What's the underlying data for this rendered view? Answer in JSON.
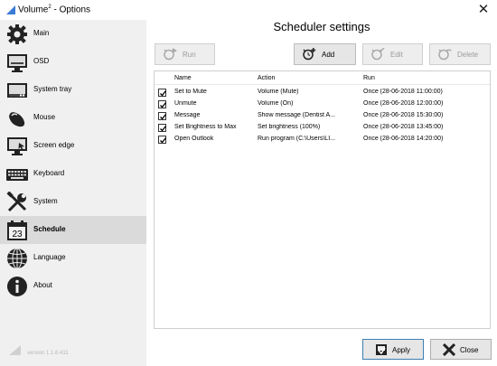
{
  "window": {
    "title_main": "Volume",
    "title_sup": "2",
    "title_suffix": " - Options",
    "close_glyph": "✕"
  },
  "sidebar": {
    "items": [
      {
        "label": "Main",
        "icon": "gear-icon"
      },
      {
        "label": "OSD",
        "icon": "monitor-icon"
      },
      {
        "label": "System tray",
        "icon": "tray-icon"
      },
      {
        "label": "Mouse",
        "icon": "mouse-icon"
      },
      {
        "label": "Screen edge",
        "icon": "screen-edge-icon"
      },
      {
        "label": "Keyboard",
        "icon": "keyboard-icon"
      },
      {
        "label": "System",
        "icon": "tools-icon"
      },
      {
        "label": "Schedule",
        "icon": "calendar-icon",
        "active": true,
        "calendar_day": "23"
      },
      {
        "label": "Language",
        "icon": "globe-icon"
      },
      {
        "label": "About",
        "icon": "info-icon"
      }
    ],
    "version": "version 1.1.6.411"
  },
  "main": {
    "heading": "Scheduler settings",
    "toolbar": {
      "run": "Run",
      "add": "Add",
      "edit": "Edit",
      "delete": "Delete"
    },
    "table": {
      "columns": [
        "Name",
        "Action",
        "Run"
      ],
      "rows": [
        {
          "checked": true,
          "name": "Set to Mute",
          "action": "Volume (Mute)",
          "run": "Once (28-06-2018 11:00:00)"
        },
        {
          "checked": true,
          "name": "Unmute",
          "action": "Volume (On)",
          "run": "Once (28-06-2018 12:00:00)"
        },
        {
          "checked": true,
          "name": "Message",
          "action": "Show message (Dentist A...",
          "run": "Once (28-06-2018 15:30:00)"
        },
        {
          "checked": true,
          "name": "Set Brightness to Max",
          "action": "Set brightness (100%)",
          "run": "Once (28-06-2018 13:45:00)"
        },
        {
          "checked": true,
          "name": "Open Outlook",
          "action": "Run program (C:\\Users\\LI...",
          "run": "Once (28-06-2018 14:20:00)"
        }
      ]
    }
  },
  "footer": {
    "apply": "Apply",
    "close": "Close"
  },
  "colors": {
    "sidebar_bg": "#f0f0f0",
    "active_bg": "#dadada",
    "apply_border": "#3c7fb1"
  }
}
